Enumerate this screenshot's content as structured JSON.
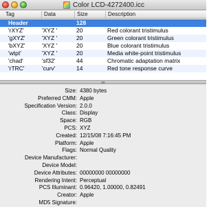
{
  "window": {
    "title": "Color LCD-4272400.icc"
  },
  "table": {
    "columns": [
      "Tag",
      "Data",
      "Size",
      "Description"
    ],
    "header_row": {
      "tag": "Header",
      "size": "128"
    },
    "rows": [
      {
        "tag": "'rXYZ'",
        "data": "'XYZ '",
        "size": "20",
        "desc": "Red colorant tristimulus"
      },
      {
        "tag": "'gXYZ'",
        "data": "'XYZ '",
        "size": "20",
        "desc": "Green colorant tristimulus"
      },
      {
        "tag": "'bXYZ'",
        "data": "'XYZ '",
        "size": "20",
        "desc": "Blue colorant tristimulus"
      },
      {
        "tag": "'wtpt'",
        "data": "'XYZ '",
        "size": "20",
        "desc": "Media white-point tristimulus"
      },
      {
        "tag": "'chad'",
        "data": "'sf32'",
        "size": "44",
        "desc": "Chromatic adaptation matrix"
      },
      {
        "tag": "'rTRC'",
        "data": "'curv'",
        "size": "14",
        "desc": "Red tone response curve"
      }
    ]
  },
  "properties": [
    {
      "label": "Size:",
      "value": "4380 bytes"
    },
    {
      "label": "Preferred CMM:",
      "value": "Apple"
    },
    {
      "label": "Specification Version:",
      "value": "2.0.0"
    },
    {
      "label": "Class:",
      "value": "Display"
    },
    {
      "label": "Space:",
      "value": "RGB"
    },
    {
      "label": "PCS:",
      "value": "XYZ"
    },
    {
      "label": "Created:",
      "value": "12/15/08 7:16:45 PM"
    },
    {
      "label": "Platform:",
      "value": "Apple"
    },
    {
      "label": "Flags:",
      "value": "Normal Quality"
    },
    {
      "label": "Device Manufacturer:",
      "value": ""
    },
    {
      "label": "Device Model:",
      "value": ""
    },
    {
      "label": "Device Attributes:",
      "value": "00000000 00000000"
    },
    {
      "label": "Rendering Intent:",
      "value": "Perceptual"
    },
    {
      "label": "PCS Illuminant:",
      "value": "0.96420, 1.00000, 0.82491"
    },
    {
      "label": "Creator:",
      "value": "Apple"
    },
    {
      "label": "MD5 Signature:",
      "value": ""
    }
  ],
  "colors": {
    "selection": "#3d80df",
    "alt_row": "#edf3fe"
  }
}
